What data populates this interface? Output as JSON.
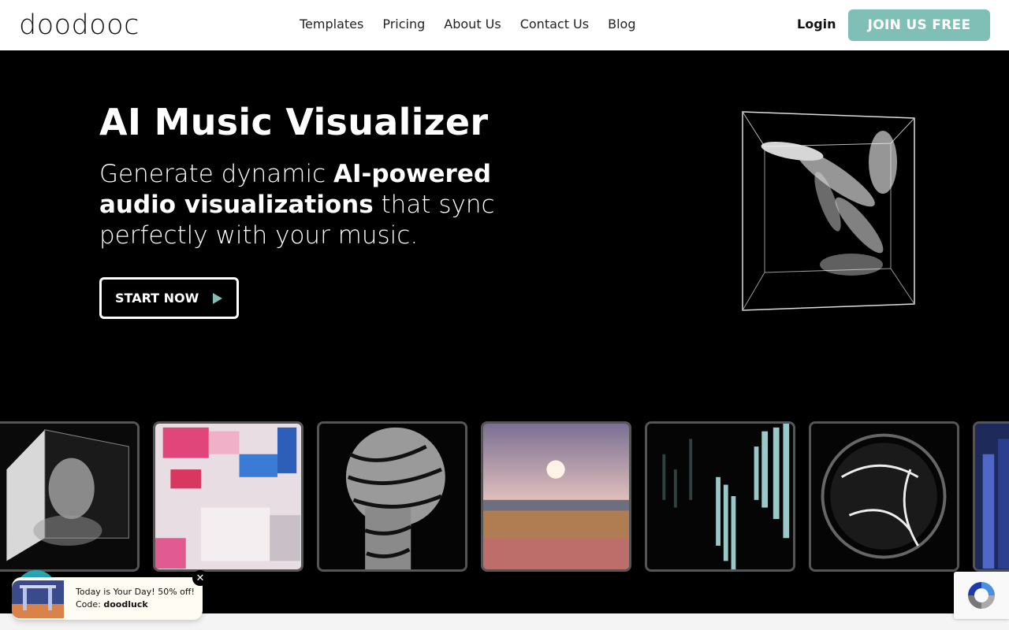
{
  "header": {
    "logo_text": "doodooc",
    "nav": [
      "Templates",
      "Pricing",
      "About Us",
      "Contact Us",
      "Blog"
    ],
    "login_label": "Login",
    "join_label": "JOIN US FREE"
  },
  "hero": {
    "title": "AI Music Visualizer",
    "subtitle_part1": "Generate dynamic ",
    "subtitle_bold1": "AI-powered audio visualizations",
    "subtitle_part2": " that sync perfectly with your music.",
    "start_label": "START NOW"
  },
  "carousel": {
    "items": [
      "cube-face-visual",
      "pink-voxel-visual",
      "striped-head-visual",
      "sunset-field-visual",
      "audio-bars-visual",
      "energy-sphere-visual",
      "blue-abstract-visual"
    ]
  },
  "promo": {
    "line1": "Today is Your Day! 50% off!",
    "code_label": "Code: ",
    "code": "doodluck",
    "close_label": "✕"
  },
  "colors": {
    "accent": "#7fbfb6",
    "hero_bg": "#000000",
    "header_bg": "#ffffff"
  }
}
